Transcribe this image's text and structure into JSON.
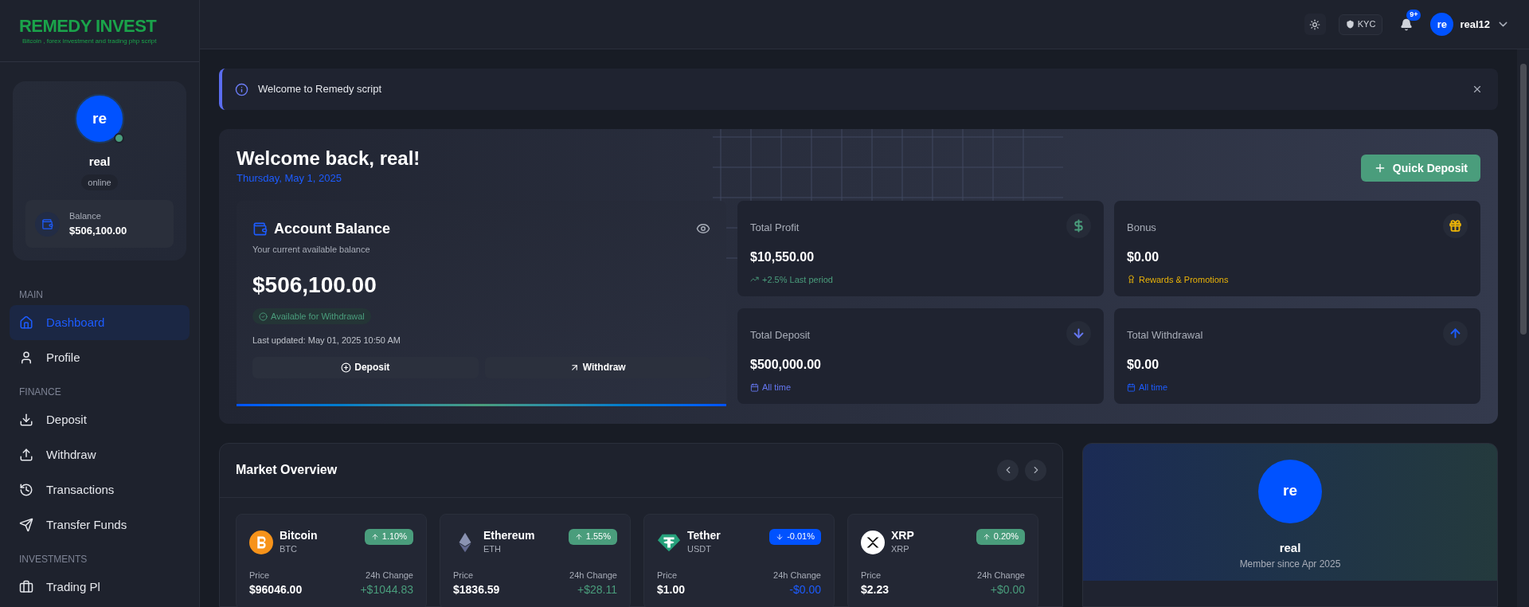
{
  "logo": {
    "title": "REMEDY INVEST",
    "tagline": "Bitcoin , forex investment and trading php script"
  },
  "sidebar": {
    "user": {
      "initials": "re",
      "name": "real",
      "status": "online",
      "online": true,
      "balance_label": "Balance",
      "balance": "$506,100.00"
    },
    "sections": [
      {
        "title": "MAIN",
        "items": [
          {
            "label": "Dashboard",
            "kind": "home",
            "selected": true
          },
          {
            "label": "Profile",
            "kind": "user",
            "selected": false
          }
        ]
      },
      {
        "title": "FINANCE",
        "items": [
          {
            "label": "Deposit",
            "kind": "download",
            "selected": false
          },
          {
            "label": "Withdraw",
            "kind": "upload",
            "selected": false
          },
          {
            "label": "Transactions",
            "kind": "history",
            "selected": false
          },
          {
            "label": "Transfer Funds",
            "kind": "send",
            "selected": false
          }
        ]
      },
      {
        "title": "INVESTMENTS",
        "items": [
          {
            "label": "Trading Pl",
            "kind": "briefcase",
            "selected": false
          }
        ]
      }
    ]
  },
  "header": {
    "kyc": "KYC",
    "notifications": "9+",
    "initials": "re",
    "username": "real12"
  },
  "alert": {
    "text": "Welcome to Remedy script"
  },
  "hero": {
    "title": "Welcome back, real!",
    "date": "Thursday, May 1, 2025",
    "quick_deposit": "Quick Deposit",
    "balance": {
      "title": "Account Balance",
      "subtitle": "Your current available balance",
      "amount": "$506,100.00",
      "badge": "Available for Withdrawal",
      "updated": "Last updated: May 01, 2025 10:50 AM",
      "deposit": "Deposit",
      "withdraw": "Withdraw"
    },
    "stats": [
      {
        "kind": "profit",
        "title": "Total Profit",
        "value": "$10,550.00",
        "note": "+2.5% Last period",
        "color": "#4a9d7c"
      },
      {
        "kind": "bonus",
        "title": "Bonus",
        "value": "$0.00",
        "note": "Rewards & Promotions",
        "color": "#eab308"
      },
      {
        "kind": "deposit",
        "title": "Total Deposit",
        "value": "$500,000.00",
        "note": "All time",
        "color": "#6577f0"
      },
      {
        "kind": "withdrawal",
        "title": "Total Withdrawal",
        "value": "$0.00",
        "note": "All time",
        "color": "#1d5cff"
      }
    ]
  },
  "market": {
    "title": "Market Overview",
    "coins": [
      {
        "kind": "btc",
        "name": "Bitcoin",
        "symbol": "BTC",
        "change": "1.10%",
        "up": true,
        "price_label": "Price",
        "change_label": "24h Change",
        "price": "$96046.00",
        "change_amount": "+$1044.83"
      },
      {
        "kind": "eth",
        "name": "Ethereum",
        "symbol": "ETH",
        "change": "1.55%",
        "up": true,
        "price_label": "Price",
        "change_label": "24h Change",
        "price": "$1836.59",
        "change_amount": "+$28.11"
      },
      {
        "kind": "usdt",
        "name": "Tether",
        "symbol": "USDT",
        "change": "-0.01%",
        "up": false,
        "price_label": "Price",
        "change_label": "24h Change",
        "price": "$1.00",
        "change_amount": "-$0.00"
      },
      {
        "kind": "xrp",
        "name": "XRP",
        "symbol": "XRP",
        "change": "0.20%",
        "up": true,
        "price_label": "Price",
        "change_label": "24h Change",
        "price": "$2.23",
        "change_amount": "+$0.00"
      }
    ]
  },
  "profile_card": {
    "initials": "re",
    "name": "real",
    "member_since": "Member since Apr 2025"
  }
}
